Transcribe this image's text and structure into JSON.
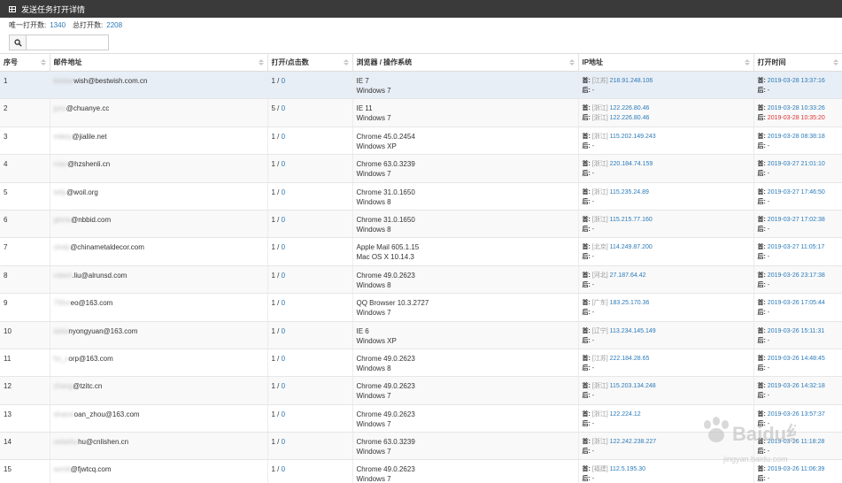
{
  "header": {
    "title": "发送任务打开详情"
  },
  "stats": {
    "unique_label": "唯一打开数:",
    "unique_value": "1340",
    "total_label": "总打开数:",
    "total_value": "2208"
  },
  "search": {
    "placeholder": ""
  },
  "columns": [
    "序号",
    "邮件地址",
    "打开/点击数",
    "浏览器 / 操作系统",
    "IP地址",
    "打开时间"
  ],
  "labels": {
    "first": "首:",
    "last": "后:",
    "slash": " / ",
    "dash": "-"
  },
  "rows": [
    {
      "no": "1",
      "email_prefix": "bestwi",
      "email_suffix": "wish@bestwish.com.cn",
      "opens": "1",
      "clicks": "0",
      "browser": "IE 7",
      "os": "Windows 7",
      "ip_first_region": "[江苏]",
      "ip_first": "218.91.248.106",
      "ip_last_region": "",
      "ip_last": "-",
      "time_first": "2019-03-28 13:37:16",
      "time_last": "-",
      "time_last_color": "",
      "selected": true
    },
    {
      "no": "2",
      "email_prefix": "jyxu",
      "email_suffix": "@chuanye.cc",
      "opens": "5",
      "clicks": "0",
      "browser": "IE 11",
      "os": "Windows 7",
      "ip_first_region": "[浙江]",
      "ip_first": "122.226.80.46",
      "ip_last_region": "[浙江]",
      "ip_last": "122.226.80.46",
      "time_first": "2019-03-28 10:33:26",
      "time_last": "2019-03-28 10:35:20",
      "time_last_color": "red"
    },
    {
      "no": "3",
      "email_prefix": "mikey",
      "email_suffix": "@jialile.net",
      "opens": "1",
      "clicks": "0",
      "browser": "Chrome 45.0.2454",
      "os": "Windows XP",
      "ip_first_region": "[浙江]",
      "ip_first": "115.202.149.243",
      "ip_last_region": "",
      "ip_last": "-",
      "time_first": "2019-03-28 08:38:18",
      "time_last": "-",
      "time_last_color": ""
    },
    {
      "no": "4",
      "email_prefix": "mao",
      "email_suffix": "@hzshenli.cn",
      "opens": "1",
      "clicks": "0",
      "browser": "Chrome 63.0.3239",
      "os": "Windows 7",
      "ip_first_region": "[浙江]",
      "ip_first": "220.184.74.159",
      "ip_last_region": "",
      "ip_last": "-",
      "time_first": "2019-03-27 21:01:10",
      "time_last": "-",
      "time_last_color": ""
    },
    {
      "no": "5",
      "email_prefix": "tetly",
      "email_suffix": "@woil.org",
      "opens": "1",
      "clicks": "0",
      "browser": "Chrome 31.0.1650",
      "os": "Windows 8",
      "ip_first_region": "[浙江]",
      "ip_first": "115.235.24.89",
      "ip_last_region": "",
      "ip_last": "-",
      "time_first": "2019-03-27 17:46:50",
      "time_last": "-",
      "time_last_color": ""
    },
    {
      "no": "6",
      "email_prefix": "gloria",
      "email_suffix": "@nbbid.com",
      "opens": "1",
      "clicks": "0",
      "browser": "Chrome 31.0.1650",
      "os": "Windows 8",
      "ip_first_region": "[浙江]",
      "ip_first": "115.215.77.160",
      "ip_last_region": "",
      "ip_last": "-",
      "time_first": "2019-03-27 17:02:38",
      "time_last": "-",
      "time_last_color": ""
    },
    {
      "no": "7",
      "email_prefix": "cindy",
      "email_suffix": "@chinametaldecor.com",
      "opens": "1",
      "clicks": "0",
      "browser": "Apple Mail 605.1.15",
      "os": "Mac OS X 10.14.3",
      "ip_first_region": "[北京]",
      "ip_first": "114.249.87.200",
      "ip_last_region": "",
      "ip_last": "-",
      "time_first": "2019-03-27 11:05:17",
      "time_last": "-",
      "time_last_color": ""
    },
    {
      "no": "8",
      "email_prefix": "robert",
      "email_suffix": ".liu@alrunsd.com",
      "opens": "1",
      "clicks": "0",
      "browser": "Chrome 49.0.2623",
      "os": "Windows 8",
      "ip_first_region": "[河北]",
      "ip_first": "27.187.64.42",
      "ip_last_region": "",
      "ip_last": "-",
      "time_first": "2019-03-26 23:17:38",
      "time_last": "-",
      "time_last_color": ""
    },
    {
      "no": "9",
      "email_prefix": "755vi",
      "email_suffix": "eo@163.com",
      "opens": "1",
      "clicks": "0",
      "browser": "QQ Browser 10.3.2727",
      "os": "Windows 7",
      "ip_first_region": "[广东]",
      "ip_first": "183.25.170.36",
      "ip_last_region": "",
      "ip_last": "-",
      "time_first": "2019-03-26 17:05:44",
      "time_last": "-",
      "time_last_color": ""
    },
    {
      "no": "10",
      "email_prefix": "dalia",
      "email_suffix": "nyongyuan@163.com",
      "opens": "1",
      "clicks": "0",
      "browser": "IE 6",
      "os": "Windows XP",
      "ip_first_region": "[辽宁]",
      "ip_first": "113.234.145.149",
      "ip_last_region": "",
      "ip_last": "-",
      "time_first": "2019-03-26 15:11:31",
      "time_last": "-",
      "time_last_color": ""
    },
    {
      "no": "11",
      "email_prefix": "hz_c",
      "email_suffix": "orp@163.com",
      "opens": "1",
      "clicks": "0",
      "browser": "Chrome 49.0.2623",
      "os": "Windows 8",
      "ip_first_region": "[江苏]",
      "ip_first": "222.184.28.65",
      "ip_last_region": "",
      "ip_last": "-",
      "time_first": "2019-03-26 14:48:45",
      "time_last": "-",
      "time_last_color": ""
    },
    {
      "no": "12",
      "email_prefix": "zhang",
      "email_suffix": "@tzitc.cn",
      "opens": "1",
      "clicks": "0",
      "browser": "Chrome 49.0.2623",
      "os": "Windows 7",
      "ip_first_region": "[浙江]",
      "ip_first": "115.203.134.248",
      "ip_last_region": "",
      "ip_last": "-",
      "time_first": "2019-03-26 14:32:18",
      "time_last": "-",
      "time_last_color": ""
    },
    {
      "no": "13",
      "email_prefix": "shaoxi",
      "email_suffix": "oan_zhou@163.com",
      "opens": "1",
      "clicks": "0",
      "browser": "Chrome 49.0.2623",
      "os": "Windows 7",
      "ip_first_region": "[浙江]",
      "ip_first": "122.224.12",
      "ip_last_region": "",
      "ip_last": "-",
      "time_first": "2019-03-26 13:57:37",
      "time_last": "-",
      "time_last_color": ""
    },
    {
      "no": "14",
      "email_prefix": "selashu",
      "email_suffix": "hu@cnlishen.cn",
      "opens": "1",
      "clicks": "0",
      "browser": "Chrome 63.0.3239",
      "os": "Windows 7",
      "ip_first_region": "[浙江]",
      "ip_first": "122.242.238.227",
      "ip_last_region": "",
      "ip_last": "-",
      "time_first": "2019-03-26 11:18:28",
      "time_last": "-",
      "time_last_color": ""
    },
    {
      "no": "15",
      "email_prefix": "semit",
      "email_suffix": "@fjwtcq.com",
      "opens": "1",
      "clicks": "0",
      "browser": "Chrome 49.0.2623",
      "os": "Windows 7",
      "ip_first_region": "[福建]",
      "ip_first": "112.5.195.30",
      "ip_last_region": "",
      "ip_last": "-",
      "time_first": "2019-03-26 11:06:39",
      "time_last": "-",
      "time_last_color": ""
    }
  ],
  "watermark": {
    "text": "Baidu经验",
    "subtext": "jingyan.baidu.com"
  },
  "colors": {
    "header_bg": "#3a3a3a",
    "link": "#2a7ab8",
    "alert": "#d33",
    "selected_row": "#e8eef6"
  }
}
